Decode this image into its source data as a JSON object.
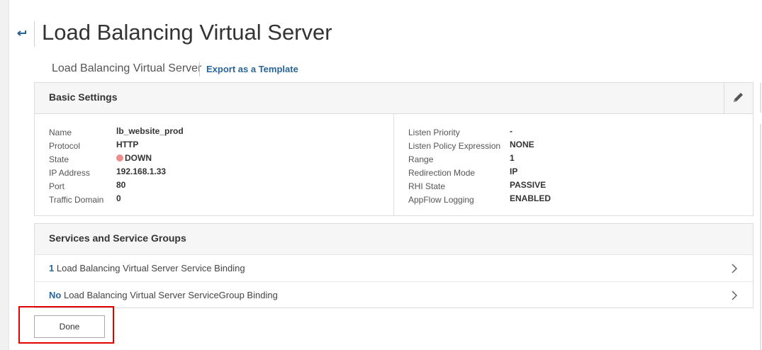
{
  "header": {
    "title": "Load Balancing Virtual Server",
    "back_icon": "back-arrow-icon"
  },
  "subheader": {
    "label": "Load Balancing Virtual Server",
    "export_link": "Export as a Template"
  },
  "basic_settings": {
    "title": "Basic Settings",
    "edit_icon": "pencil-icon",
    "left": [
      {
        "key": "Name",
        "value": "lb_website_prod"
      },
      {
        "key": "Protocol",
        "value": "HTTP"
      },
      {
        "key": "State",
        "value": "DOWN",
        "status_color": "#ef8c8c"
      },
      {
        "key": "IP Address",
        "value": "192.168.1.33"
      },
      {
        "key": "Port",
        "value": "80"
      },
      {
        "key": "Traffic Domain",
        "value": "0"
      }
    ],
    "right": [
      {
        "key": "Listen Priority",
        "value": "-"
      },
      {
        "key": "Listen Policy Expression",
        "value": "NONE"
      },
      {
        "key": "Range",
        "value": "1"
      },
      {
        "key": "Redirection Mode",
        "value": "IP"
      },
      {
        "key": "RHI State",
        "value": "PASSIVE"
      },
      {
        "key": "AppFlow Logging",
        "value": "ENABLED"
      }
    ]
  },
  "services": {
    "title": "Services and Service Groups",
    "rows": [
      {
        "count": "1",
        "label": "Load Balancing Virtual Server Service Binding"
      },
      {
        "count": "No",
        "label": "Load Balancing Virtual Server ServiceGroup Binding"
      }
    ]
  },
  "footer": {
    "done_label": "Done"
  },
  "colors": {
    "link": "#2a6496",
    "highlight": "#e00000",
    "status_down": "#ef8c8c"
  }
}
